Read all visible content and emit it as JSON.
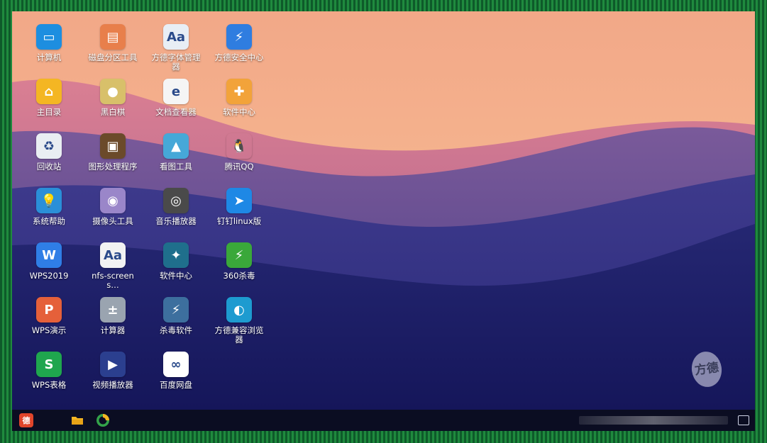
{
  "desktop": {
    "icons": [
      {
        "name": "computer-icon",
        "label": "计算机",
        "glyph": "▭",
        "bg": "#1d8ee0"
      },
      {
        "name": "home-folder-icon",
        "label": "主目录",
        "glyph": "⌂",
        "bg": "#f4b623"
      },
      {
        "name": "recycle-bin-icon",
        "label": "回收站",
        "glyph": "♻",
        "bg": "#e9eef2"
      },
      {
        "name": "help-bulb-icon",
        "label": "系统帮助",
        "glyph": "💡",
        "bg": "#2a8fd8"
      },
      {
        "name": "wps-writer-icon",
        "label": "WPS2019",
        "glyph": "W",
        "bg": "#2f7ee6"
      },
      {
        "name": "wps-presentation-icon",
        "label": "WPS演示",
        "glyph": "P",
        "bg": "#e5603a"
      },
      {
        "name": "wps-spreadsheet-icon",
        "label": "WPS表格",
        "glyph": "S",
        "bg": "#1fa64e"
      },
      {
        "name": "disk-partition-icon",
        "label": "磁盘分区工具",
        "glyph": "▤",
        "bg": "#e87f4b"
      },
      {
        "name": "go-game-icon",
        "label": "黑白棋",
        "glyph": "●",
        "bg": "#d8c06a"
      },
      {
        "name": "image-editor-icon",
        "label": "图形处理程序",
        "glyph": "▣",
        "bg": "#6b4a2a"
      },
      {
        "name": "camera-tool-icon",
        "label": "摄像头工具",
        "glyph": "◉",
        "bg": "#9a86c9"
      },
      {
        "name": "screenshot-tool-icon",
        "label": "nfs-screens…",
        "glyph": "Aa",
        "bg": "#f2f2f2"
      },
      {
        "name": "calculator-icon",
        "label": "计算器",
        "glyph": "±",
        "bg": "#9aa4b0"
      },
      {
        "name": "video-player-icon",
        "label": "视频播放器",
        "glyph": "▶",
        "bg": "#2b3f8f"
      },
      {
        "name": "font-manager-icon",
        "label": "方德字体管理器",
        "glyph": "Aa",
        "bg": "#e8eef5"
      },
      {
        "name": "document-viewer-icon",
        "label": "文档查看器",
        "glyph": "e",
        "bg": "#f5f5f5"
      },
      {
        "name": "image-viewer-icon",
        "label": "看图工具",
        "glyph": "▲",
        "bg": "#46a8d8"
      },
      {
        "name": "music-player-icon",
        "label": "音乐播放器",
        "glyph": "◎",
        "bg": "#4a4a4a"
      },
      {
        "name": "software-center-icon",
        "label": "软件中心",
        "glyph": "✦",
        "bg": "#1f6f8c"
      },
      {
        "name": "antivirus-icon",
        "label": "杀毒软件",
        "glyph": "⚡",
        "bg": "#3d6f9e"
      },
      {
        "name": "baidu-netdisk-icon",
        "label": "百度网盘",
        "glyph": "∞",
        "bg": "#ffffff"
      },
      {
        "name": "security-center-icon",
        "label": "方德安全中心",
        "glyph": "⚡",
        "bg": "#2f7de0"
      },
      {
        "name": "software-store-icon",
        "label": "软件中心",
        "glyph": "✚",
        "bg": "#f2a33a"
      },
      {
        "name": "qq-icon",
        "label": "腾讯QQ",
        "glyph": "🐧",
        "bg": "transparent"
      },
      {
        "name": "dingtalk-icon",
        "label": "钉钉linux版",
        "glyph": "➤",
        "bg": "#1e88e5"
      },
      {
        "name": "360-antivirus-icon",
        "label": "360杀毒",
        "glyph": "⚡",
        "bg": "#3aa83a"
      },
      {
        "name": "browser-icon",
        "label": "方德兼容浏览器",
        "glyph": "◐",
        "bg": "#1d9bd0"
      }
    ]
  },
  "watermark": {
    "text": "方德"
  },
  "taskbar": {
    "start_glyph": "德",
    "colors": {
      "start": "#e0452b",
      "files": "#f4b623",
      "browser": "#33a34a"
    }
  }
}
